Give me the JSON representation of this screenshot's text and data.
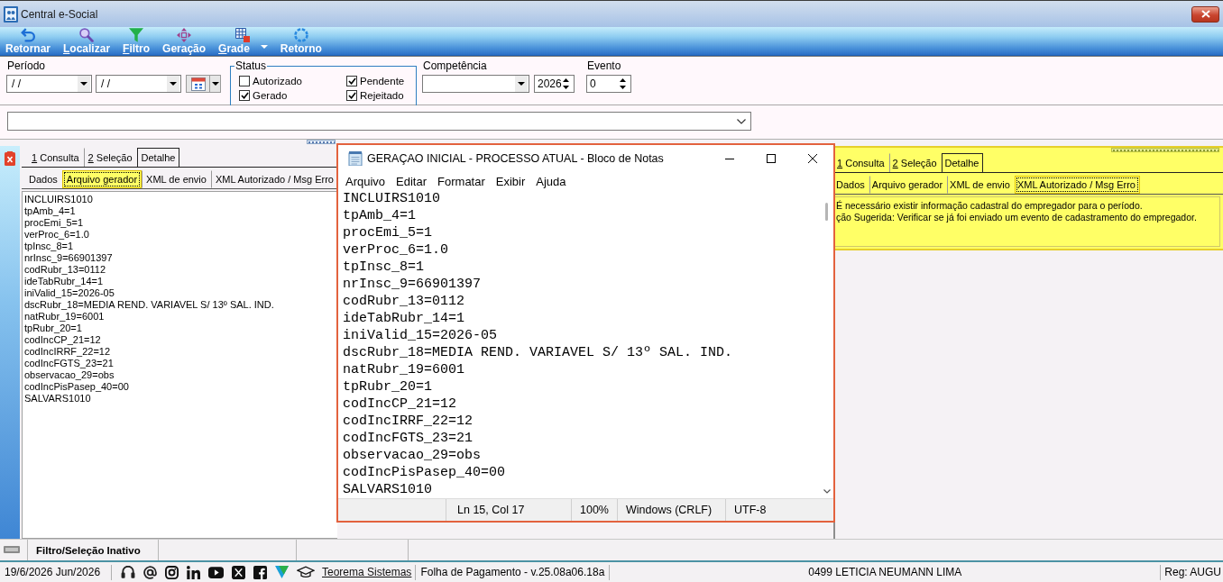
{
  "window": {
    "title": "Central e-Social"
  },
  "toolbar": [
    {
      "label": "Retornar",
      "mnemonic": false,
      "dropdown": false
    },
    {
      "label": "Localizar",
      "mnemonic": true,
      "dropdown": false
    },
    {
      "label": "Filtro",
      "mnemonic": true,
      "dropdown": false
    },
    {
      "label": "Geração",
      "mnemonic": false,
      "dropdown": false
    },
    {
      "label": "Grade",
      "mnemonic": true,
      "dropdown": true
    },
    {
      "label": "Retorno",
      "mnemonic": false,
      "dropdown": false
    }
  ],
  "filters": {
    "period": {
      "label": "Período",
      "fields": [
        {
          "value": "/ /"
        },
        {
          "value": "/ /"
        }
      ]
    },
    "status": {
      "legend": "Status",
      "options": [
        {
          "label": "Autorizado",
          "checked": false
        },
        {
          "label": "Pendente",
          "checked": true
        },
        {
          "label": "Gerado",
          "checked": true
        },
        {
          "label": "Rejeitado",
          "checked": true
        }
      ]
    },
    "competence": {
      "label": "Competência",
      "year": "2026"
    },
    "event": {
      "label": "Evento",
      "value": "0"
    }
  },
  "left_panel": {
    "tabs": [
      {
        "label": "1 Consulta",
        "mnemonic": true,
        "selected": false
      },
      {
        "label": "2 Seleção",
        "mnemonic": true,
        "selected": false
      },
      {
        "label": "Detalhe",
        "mnemonic": false,
        "selected": true
      }
    ],
    "subtabs": [
      {
        "label": "Dados",
        "selected": false
      },
      {
        "label": "Arquivo gerador",
        "selected": true
      },
      {
        "label": "XML de envio",
        "selected": false
      },
      {
        "label": "XML Autorizado / Msg Erro",
        "selected": false
      }
    ],
    "lines": [
      "INCLUIRS1010",
      "tpAmb_4=1",
      "procEmi_5=1",
      "verProc_6=1.0",
      "tpInsc_8=1",
      "nrInsc_9=66901397",
      "codRubr_13=0112",
      "ideTabRubr_14=1",
      "iniValid_15=2026-05",
      "dscRubr_18=MEDIA REND. VARIAVEL S/ 13º SAL. IND.",
      "natRubr_19=6001",
      "tpRubr_20=1",
      "codIncCP_21=12",
      "codIncIRRF_22=12",
      "codIncFGTS_23=21",
      "observacao_29=obs",
      "codIncPisPasep_40=00",
      "SALVARS1010"
    ]
  },
  "notepad": {
    "title": "GERAÇAO INICIAL - PROCESSO ATUAL - Bloco de Notas",
    "menu": [
      "Arquivo",
      "Editar",
      "Formatar",
      "Exibir",
      "Ajuda"
    ],
    "lines": [
      "INCLUIRS1010",
      "tpAmb_4=1",
      "procEmi_5=1",
      "verProc_6=1.0",
      "tpInsc_8=1",
      "nrInsc_9=66901397",
      "codRubr_13=0112",
      "ideTabRubr_14=1",
      "iniValid_15=2026-05",
      "dscRubr_18=MEDIA REND. VARIAVEL S/ 13º SAL. IND.",
      "natRubr_19=6001",
      "tpRubr_20=1",
      "codIncCP_21=12",
      "codIncIRRF_22=12",
      "codIncFGTS_23=21",
      "observacao_29=obs",
      "codIncPisPasep_40=00",
      "SALVARS1010"
    ],
    "status": [
      "Ln 15, Col 17",
      "100%",
      "Windows (CRLF)",
      "UTF-8"
    ]
  },
  "right_panel": {
    "highlighted": true,
    "tabs": [
      {
        "label": "1 Consulta",
        "mnemonic": true,
        "selected": false
      },
      {
        "label": "2 Seleção",
        "mnemonic": true,
        "selected": false
      },
      {
        "label": "Detalhe",
        "mnemonic": false,
        "selected": true
      }
    ],
    "subtabs": [
      {
        "label": "Dados",
        "selected": false
      },
      {
        "label": "Arquivo gerador",
        "selected": false
      },
      {
        "label": "XML de envio",
        "selected": false
      },
      {
        "label": "XML Autorizado / Msg Erro",
        "selected": true
      }
    ],
    "lines": [
      "É necessário existir informação cadastral do empregador para o período.",
      "ção Sugerida: Verificar se já foi enviado um evento de cadastramento do empregador."
    ]
  },
  "filter_bar": {
    "status": "Filtro/Seleção Inativo"
  },
  "status_bar": {
    "date": "19/6/2026 Jun/2026",
    "link": "Teorema Sistemas",
    "product": "Folha de Pagamento - v.25.08a06.18a",
    "user": "0499 LETICIA NEUMANN LIMA",
    "register": "Reg: AUGU"
  }
}
